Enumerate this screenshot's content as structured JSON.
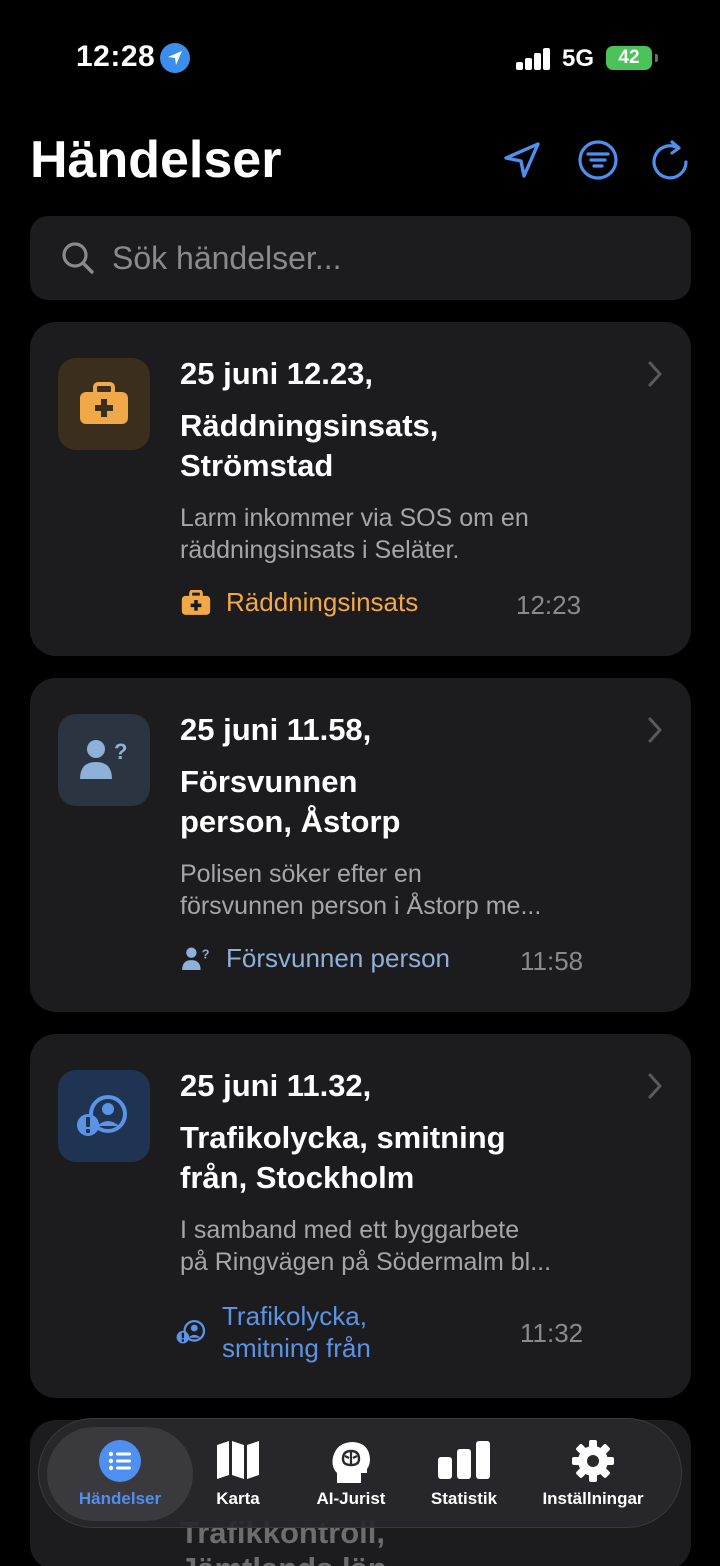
{
  "status_bar": {
    "time": "12:28",
    "network": "5G",
    "battery": "42"
  },
  "header": {
    "title": "Händelser"
  },
  "search": {
    "placeholder": "Sök händelser..."
  },
  "events": [
    {
      "date": "25 juni 12.23,",
      "title_line1": "Räddningsinsats,",
      "title_line2": "Strömstad",
      "desc_line1": "Larm inkommer via SOS om en",
      "desc_line2": "räddningsinsats i Seläter.",
      "category": "Räddningsinsats",
      "time": "12:23",
      "color": "#f0a848"
    },
    {
      "date": "25 juni 11.58,",
      "title_line1": "Försvunnen",
      "title_line2": "person, Åstorp",
      "desc_line1": "Polisen söker efter en",
      "desc_line2": "försvunnen person i Åstorp me...",
      "category": "Försvunnen person",
      "time": "11:58",
      "color": "#8fb0d8"
    },
    {
      "date": "25 juni 11.32,",
      "title_line1": "Trafikolycka, smitning",
      "title_line2": "från, Stockholm",
      "desc_line1": "I samband med ett byggarbete",
      "desc_line2": "på Ringvägen på Södermalm bl...",
      "category_line1": "Trafikolycka,",
      "category_line2": "smitning från",
      "time": "11:32",
      "color": "#5b93e6"
    }
  ],
  "partial_event": {
    "line1": "Trafikkontroll,",
    "line2": "Jämtlands län"
  },
  "tabs": [
    {
      "label": "Händelser",
      "icon": "list-icon"
    },
    {
      "label": "Karta",
      "icon": "map-icon"
    },
    {
      "label": "AI-Jurist",
      "icon": "brain-icon"
    },
    {
      "label": "Statistik",
      "icon": "chart-icon"
    },
    {
      "label": "Inställningar",
      "icon": "gear-icon"
    }
  ]
}
